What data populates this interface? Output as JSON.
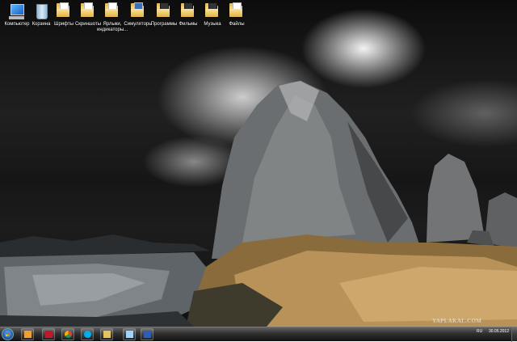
{
  "desktop": {
    "icons": [
      {
        "label": "Компьютер",
        "icon": "computer-icon"
      },
      {
        "label": "Корзина",
        "icon": "recycle-bin-icon"
      },
      {
        "label": "Шрифты",
        "icon": "folder-icon"
      },
      {
        "label": "Скриншоты",
        "icon": "folder-icon"
      },
      {
        "label": "Ярлыки, индикаторы...",
        "icon": "folder-icon"
      },
      {
        "label": "Симуляторы",
        "icon": "folder-icon"
      },
      {
        "label": "Программы",
        "icon": "folder-icon"
      },
      {
        "label": "Фильмы",
        "icon": "folder-icon"
      },
      {
        "label": "Музыка",
        "icon": "folder-icon"
      },
      {
        "label": "Файлы",
        "icon": "folder-icon"
      }
    ],
    "watermark": "YAPLAKAL.COM"
  },
  "taskbar": {
    "start_icon": "windows-orb-icon",
    "pinned": [
      {
        "icon": "media-player-icon",
        "color": "#f0a030"
      },
      {
        "icon": "antivirus-icon",
        "color": "#c0182a"
      },
      {
        "icon": "chrome-icon",
        "color": "#4caf50"
      },
      {
        "icon": "skype-icon",
        "color": "#00aff0"
      },
      {
        "icon": "explorer-icon",
        "color": "#e6c25f"
      },
      {
        "icon": "window-icon",
        "color": "#9fd4ff"
      },
      {
        "icon": "word-icon",
        "color": "#2b5fb6"
      }
    ],
    "tray": {
      "language": "RU",
      "time": "",
      "date": "30.05.2012"
    }
  }
}
